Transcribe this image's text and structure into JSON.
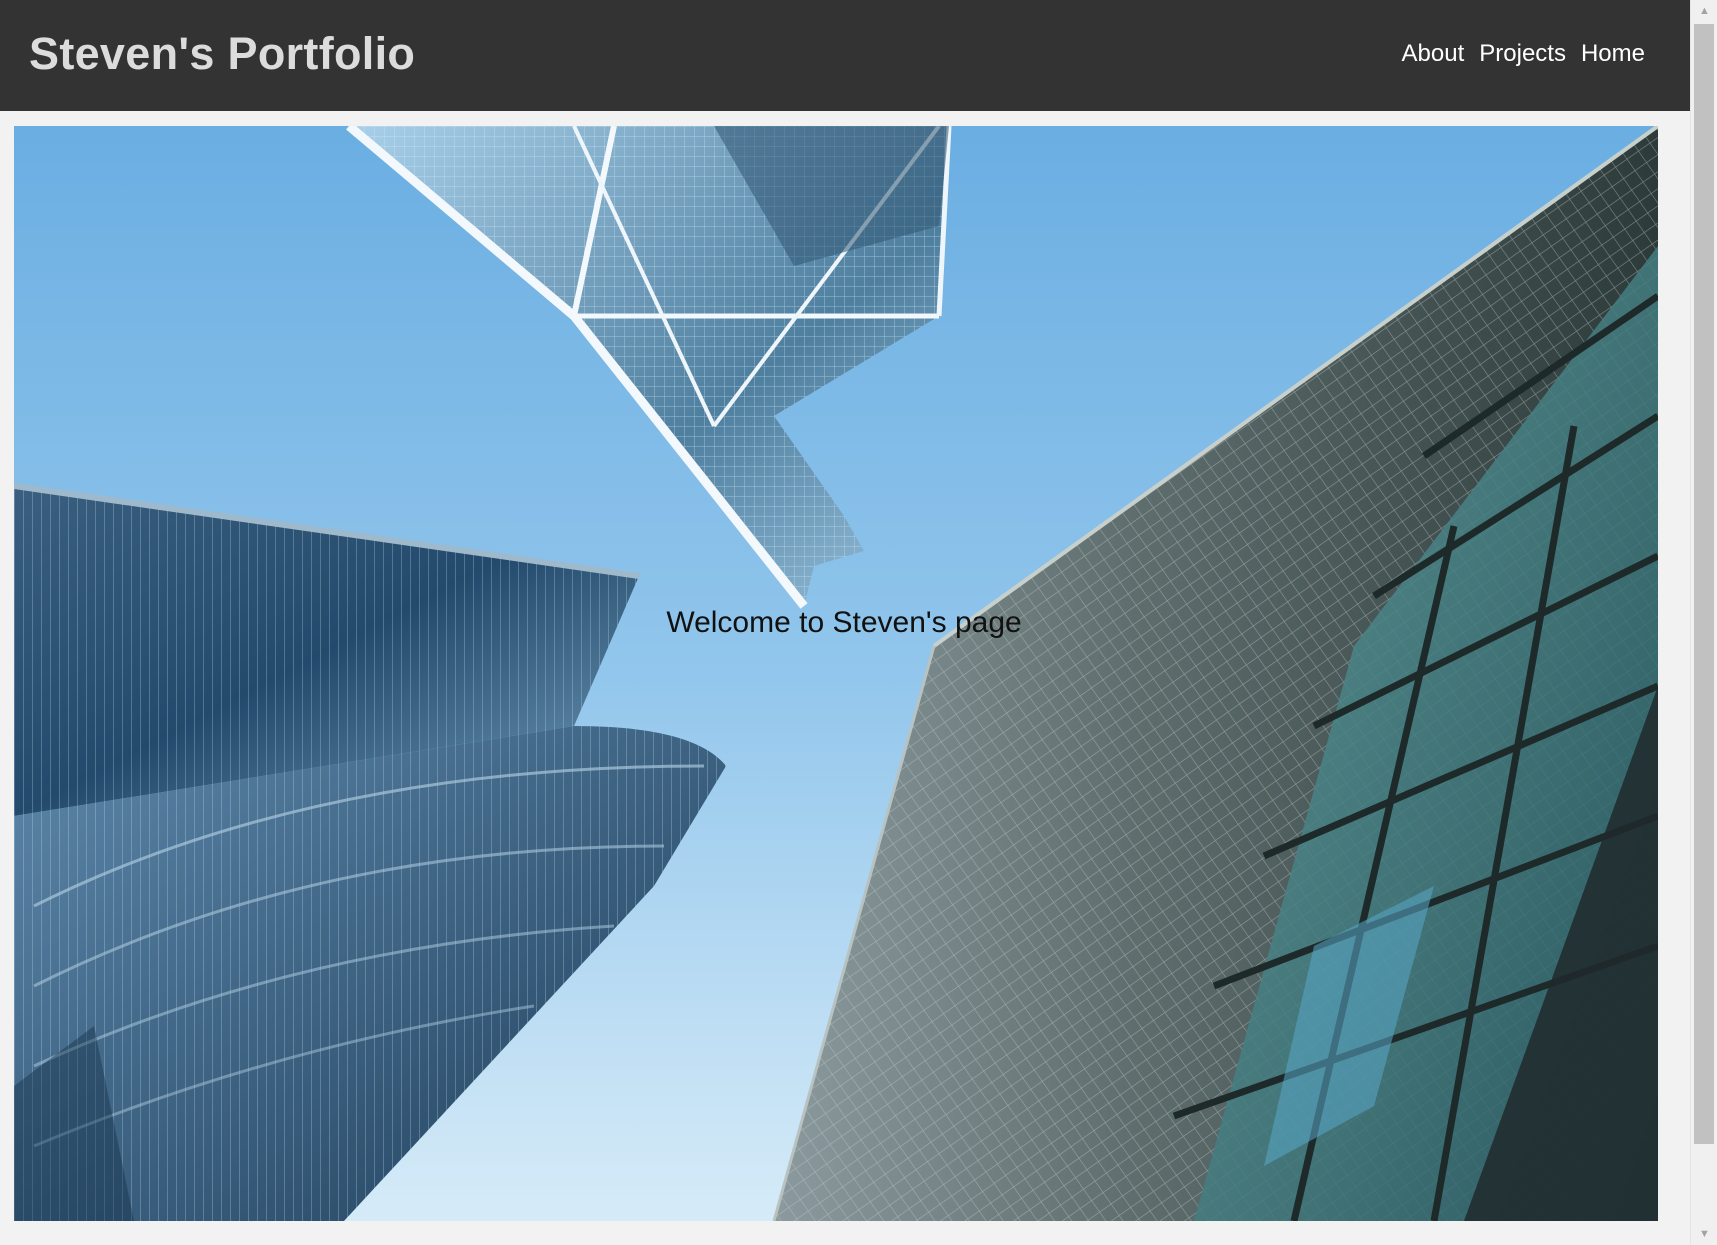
{
  "header": {
    "title": "Steven's Portfolio",
    "nav": [
      {
        "label": "About"
      },
      {
        "label": "Projects"
      },
      {
        "label": "Home"
      }
    ]
  },
  "hero": {
    "welcome_text": "Welcome to Steven's page",
    "image_description": "upward-view-of-glass-skyscrapers"
  },
  "colors": {
    "header_bg": "#333333",
    "title_color": "#dcdcdc",
    "nav_color": "#ffffff",
    "page_bg": "#f2f2f2"
  },
  "icons": {
    "scroll_up": "scroll-up-arrow-icon",
    "scroll_down": "scroll-down-arrow-icon"
  }
}
